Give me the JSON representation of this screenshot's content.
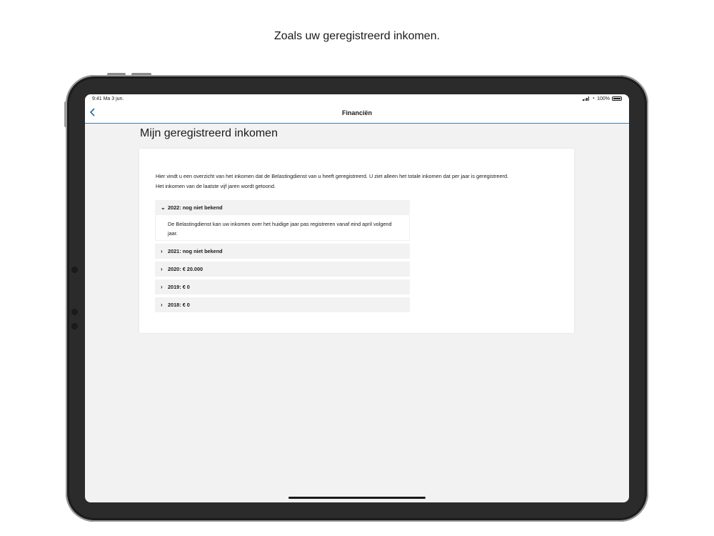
{
  "caption": "Zoals uw geregistreerd inkomen.",
  "status": {
    "time": "9:41",
    "date": "Ma 3 jun.",
    "battery": "100%"
  },
  "nav": {
    "back_icon": "chevron-left-icon",
    "title": "Financiën"
  },
  "page": {
    "title": "Mijn geregistreerd inkomen"
  },
  "intro": {
    "line1": "Hier vindt u een overzicht van het inkomen dat de Belastingdienst van u heeft geregistreerd. U ziet alleen het totale inkomen dat per jaar is geregistreerd.",
    "line2": "Het inkomen van de laatste vijf jaren wordt getoond."
  },
  "accordion": [
    {
      "label": "2022: nog niet bekend",
      "expanded": true,
      "chevron": "⌄",
      "body": "De Belastingdienst kan uw inkomen over het huidige jaar pas registreren vanaf eind april volgend jaar."
    },
    {
      "label": "2021: nog niet bekend",
      "expanded": false,
      "chevron": "›"
    },
    {
      "label": "2020: € 20.000",
      "expanded": false,
      "chevron": "›"
    },
    {
      "label": "2019: € 0",
      "expanded": false,
      "chevron": "›"
    },
    {
      "label": "2018: € 0",
      "expanded": false,
      "chevron": "›"
    }
  ],
  "colors": {
    "accent": "#1b6ca8",
    "background": "#f2f2f2",
    "card": "#ffffff"
  }
}
